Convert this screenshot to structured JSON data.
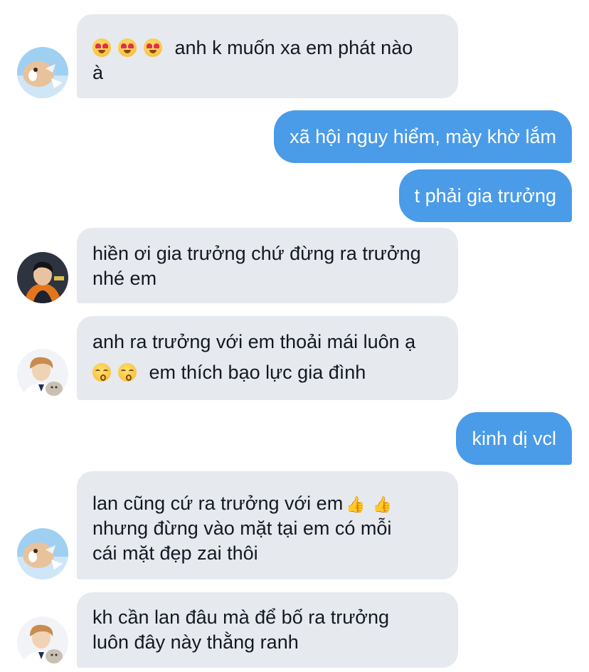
{
  "conversation": {
    "messages": [
      {
        "direction": "incoming",
        "avatar": "cat-avatar",
        "emoji": [
          "heart-eyes",
          "heart-eyes",
          "heart-eyes"
        ],
        "lines": [
          "anh k muốn xa em phát nào",
          "à"
        ]
      },
      {
        "direction": "outgoing",
        "text": "xã hội nguy hiểm, mày khờ lắm"
      },
      {
        "direction": "outgoing",
        "text": "t phải gia trưởng"
      },
      {
        "direction": "incoming",
        "avatar": "boy-avatar",
        "lines": [
          "hiền ơi gia trưởng chứ đừng ra trưởng",
          "nhé em"
        ]
      },
      {
        "direction": "incoming",
        "avatar": "boy-with-cat-avatar",
        "lines": [
          "anh ra trưởng với em thoải mái luôn ạ",
          "em thích bạo lực gia đình"
        ],
        "emoji_line2": [
          "kissing-face",
          "kissing-face"
        ]
      },
      {
        "direction": "outgoing",
        "text": "kinh dị vcl"
      },
      {
        "direction": "incoming",
        "avatar": "cat-avatar",
        "lines": [
          "lan cũng cứ ra trưởng với em",
          "nhưng đừng vào mặt tại em có mỗi",
          "cái mặt đẹp zai thôi"
        ],
        "emoji_line1": [
          "thumbs-up",
          "thumbs-up"
        ]
      },
      {
        "direction": "incoming",
        "avatar": "boy-with-cat-avatar",
        "lines": [
          "kh cần lan đâu mà để bố ra trưởng",
          "luôn đây này thằng ranh"
        ]
      }
    ]
  },
  "colors": {
    "incoming_bubble": "#e6e9ee",
    "outgoing_bubble": "#4a9be8",
    "incoming_text": "#141823",
    "outgoing_text": "#ffffff",
    "background": "#ffffff"
  }
}
